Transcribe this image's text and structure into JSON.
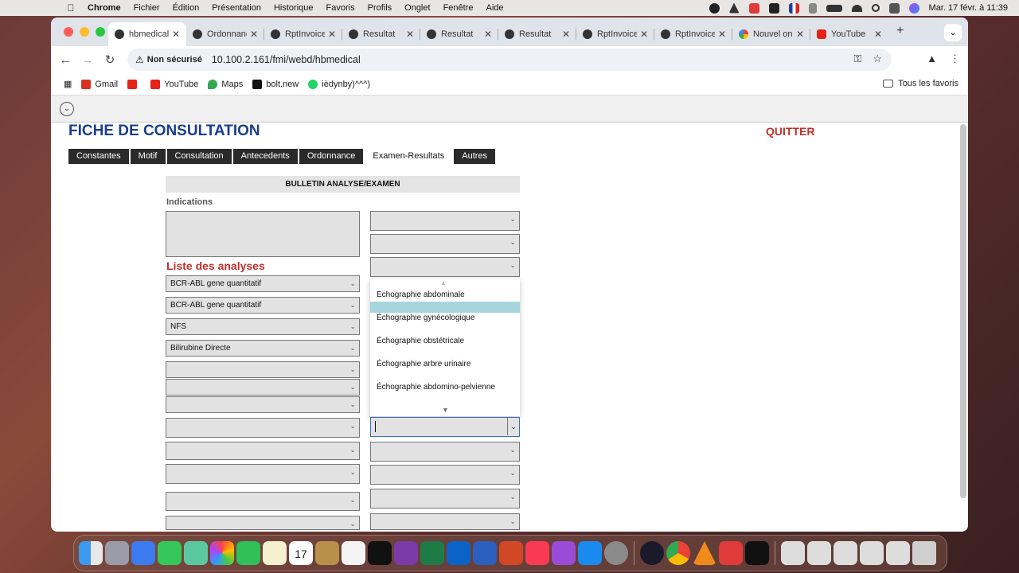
{
  "menubar": {
    "app": "Chrome",
    "items": [
      "Fichier",
      "Édition",
      "Présentation",
      "Historique",
      "Favoris",
      "Profils",
      "Onglet",
      "Fenêtre",
      "Aide"
    ],
    "datetime": "Mar. 17 févr. à  11:39"
  },
  "tabs": [
    {
      "label": "hbmedical",
      "icon": "globe-icon",
      "active": true
    },
    {
      "label": "Ordonnance",
      "icon": "globe-icon"
    },
    {
      "label": "RptInvoice",
      "icon": "globe-icon"
    },
    {
      "label": "Resultat",
      "icon": "globe-icon"
    },
    {
      "label": "Resultat",
      "icon": "globe-icon"
    },
    {
      "label": "Resultat",
      "icon": "globe-icon"
    },
    {
      "label": "RptInvoice",
      "icon": "globe-icon"
    },
    {
      "label": "RptInvoice",
      "icon": "globe-icon"
    },
    {
      "label": "Nouvel onglet",
      "icon": "chrome-icon"
    },
    {
      "label": "YouTube",
      "icon": "youtube-icon"
    }
  ],
  "address": {
    "security": "Non sécurisé",
    "url": "10.100.2.161/fmi/webd/hbmedical"
  },
  "bookmarks": [
    {
      "label": "Gmail",
      "color": "#d93025"
    },
    {
      "label": "",
      "color": "#e62117"
    },
    {
      "label": "YouTube",
      "color": "#e62117"
    },
    {
      "label": "Maps",
      "color": "#34a853"
    },
    {
      "label": "bolt.new",
      "color": "#111111"
    },
    {
      "label": "ièdynby)^^^)",
      "color": "#25d366"
    }
  ],
  "all_bookmarks": "Tous les favoris",
  "page": {
    "title": "FICHE DE CONSULTATION",
    "quit": "QUITTER",
    "tabs": [
      "Constantes",
      "Motif",
      "Consultation",
      "Antecedents",
      "Ordonnance",
      "Examen-Resultats",
      "Autres"
    ],
    "active_tab": "Examen-Resultats",
    "bulletin_header": "BULLETIN ANALYSE/EXAMEN",
    "indications_label": "Indications",
    "analyses_label": "Liste des analyses",
    "analyses": [
      "BCR-ABL gene quantitatif",
      "BCR-ABL gene quantitatif",
      "NFS",
      "Bilirubine  Directe",
      "",
      "",
      "",
      "",
      "",
      "",
      "",
      ""
    ],
    "dropdown_options": [
      "Echographie abdominale",
      "Échographie gynécologique",
      "Échographie obstétricale",
      "Échographie arbre urinaire",
      "Échographie abdomino-pelvienne"
    ],
    "dropdown_highlighted": "Échographie gynécologique"
  },
  "colors": {
    "title": "#1a3d8f",
    "quit": "#c0302a",
    "tab_bg": "#2a2a2a",
    "highlight": "#a8d5dc"
  }
}
